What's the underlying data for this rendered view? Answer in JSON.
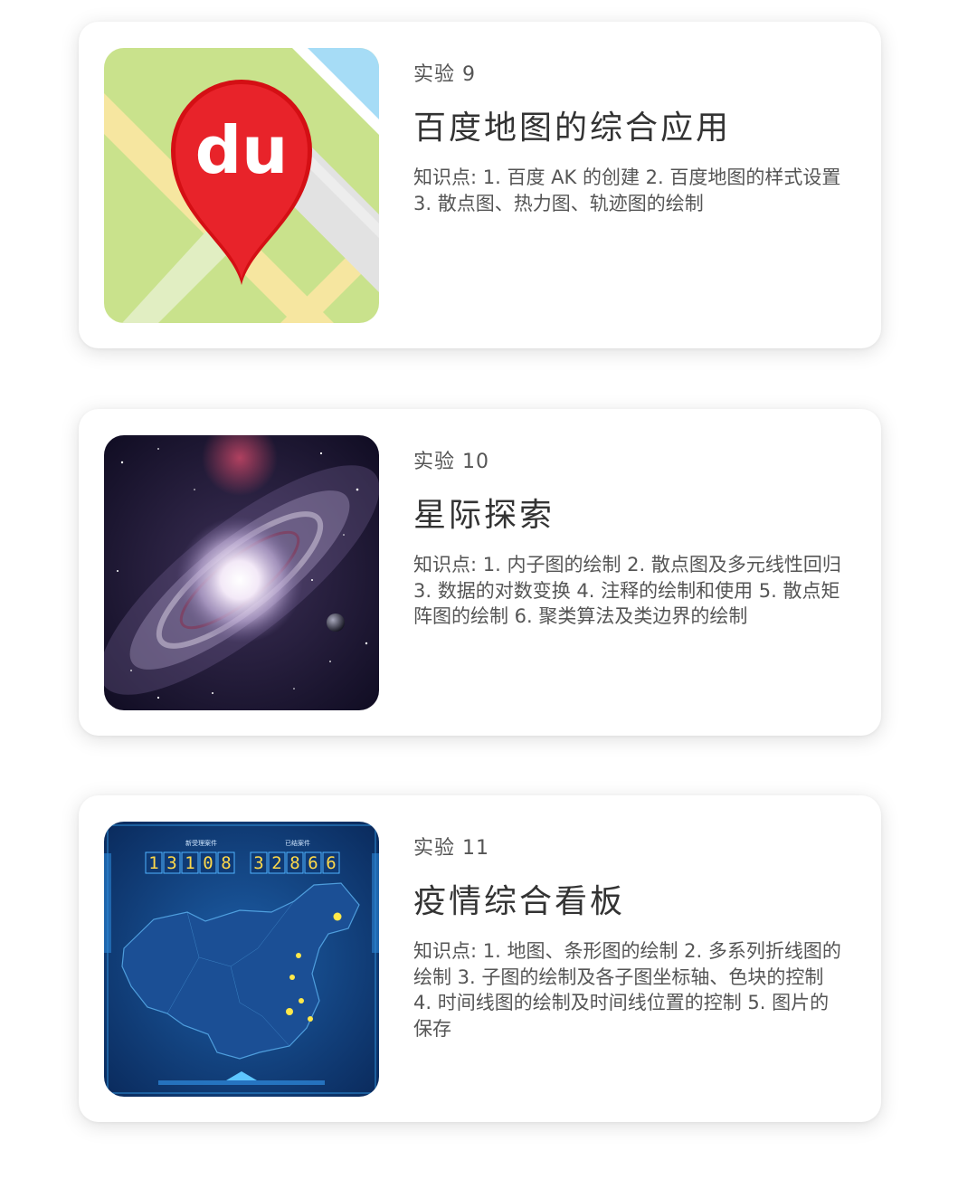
{
  "cards": [
    {
      "label": "实验 9",
      "title": "百度地图的综合应用",
      "desc": "知识点: 1. 百度 AK 的创建 2. 百度地图的样式设置 3. 散点图、热力图、轨迹图的绘制",
      "logo_text": "du"
    },
    {
      "label": "实验 10",
      "title": "星际探索",
      "desc": "知识点: 1. 内子图的绘制 2. 散点图及多元线性回归 3. 数据的对数变换 4. 注释的绘制和使用 5. 散点矩阵图的绘制 6. 聚类算法及类边界的绘制"
    },
    {
      "label": "实验 11",
      "title": "疫情综合看板",
      "desc": "知识点: 1. 地图、条形图的绘制 2. 多系列折线图的绘制 3. 子图的绘制及各子图坐标轴、色块的控制 4. 时间线图的绘制及时间线位置的控制 5. 图片的保存",
      "dashboard": {
        "left_label": "新受理案件",
        "right_label": "已结案件",
        "left_digits": [
          "1",
          "3",
          "1",
          "0",
          "8"
        ],
        "right_digits": [
          "3",
          "2",
          "8",
          "6",
          "6"
        ]
      }
    }
  ]
}
